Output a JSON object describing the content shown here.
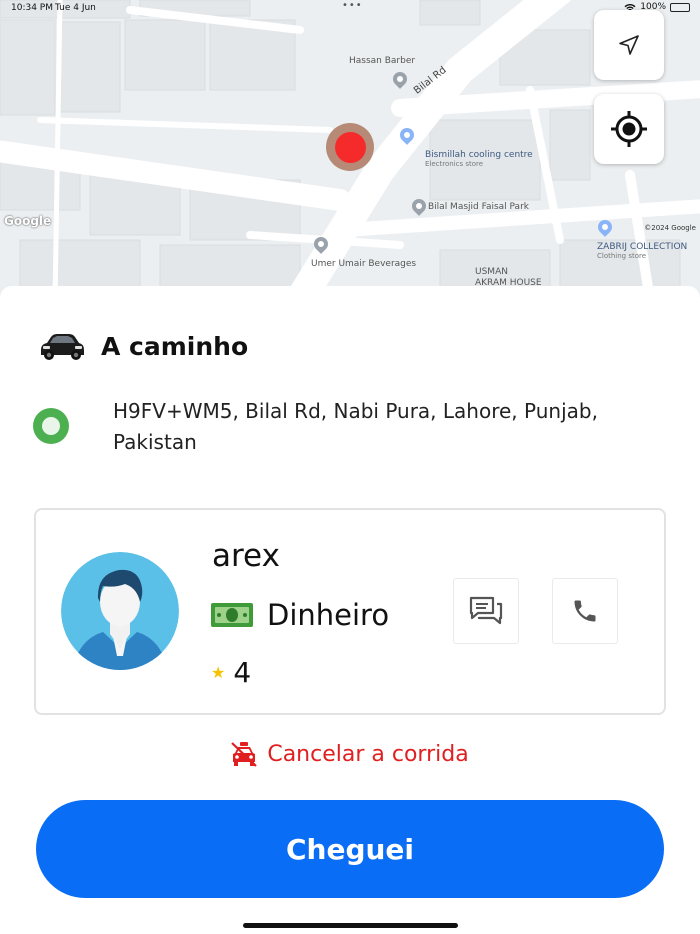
{
  "status_bar": {
    "time": "10:34 PM",
    "date": "Tue 4 Jun",
    "dots": "•••",
    "battery": "100%"
  },
  "map": {
    "labels": {
      "hassan_barber": "Hassan Barber",
      "bilal_rd": "Bilal Rd",
      "bismillah": "Bismillah cooling centre",
      "bismillah_sub": "Electronics store",
      "masjid": "Bilal Masjid Faisal Park",
      "umer": "Umer Umair Beverages",
      "zabrij": "ZABRIJ COLLECTION",
      "zabrij_sub": "Clothing store",
      "usman": "USMAN",
      "akram": "AKRAM HOUSE"
    },
    "google": "Google",
    "copyright": "©2024 Google",
    "buttons": {
      "navigate_icon": "navigate-arrow-icon",
      "locate_icon": "my-location-icon"
    }
  },
  "ride": {
    "status": "A caminho",
    "vehicle_icon": "car-icon",
    "address": "H9FV+WM5, Bilal Rd, Nabi Pura, Lahore, Punjab, Pakistan"
  },
  "driver": {
    "name": "arex",
    "payment": "Dinheiro",
    "rating": "4",
    "avatar_icon": "avatar-icon",
    "chat_icon": "chat-icon",
    "call_icon": "phone-icon"
  },
  "actions": {
    "cancel": "Cancelar a corrida",
    "arrived": "Cheguei"
  },
  "colors": {
    "accent": "#0a6df5",
    "cancel": "#e02020",
    "pickup_dot": "#4caf50",
    "marker": "#f52b2b",
    "star": "#f5c400"
  }
}
